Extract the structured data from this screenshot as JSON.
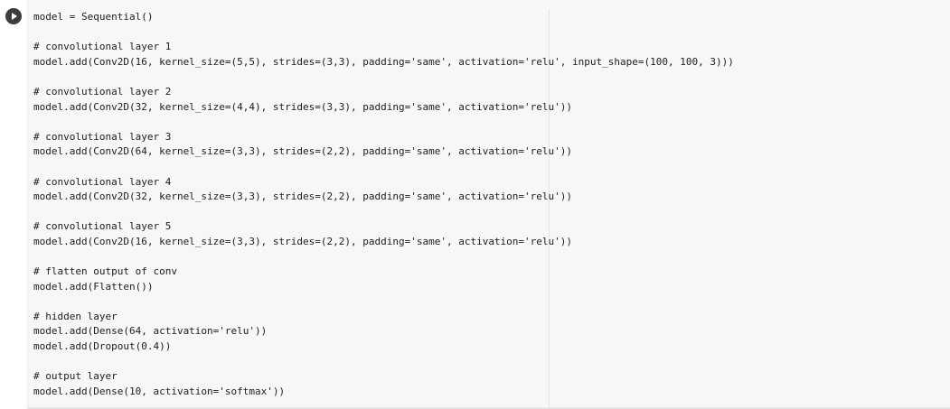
{
  "toolbar": {
    "run_icon": "play-icon"
  },
  "code_lines": [
    "model = Sequential()",
    "",
    "# convolutional layer 1",
    "model.add(Conv2D(16, kernel_size=(5,5), strides=(3,3), padding='same', activation='relu', input_shape=(100, 100, 3)))",
    "",
    "# convolutional layer 2",
    "model.add(Conv2D(32, kernel_size=(4,4), strides=(3,3), padding='same', activation='relu'))",
    "",
    "# convolutional layer 3",
    "model.add(Conv2D(64, kernel_size=(3,3), strides=(2,2), padding='same', activation='relu'))",
    "",
    "# convolutional layer 4",
    "model.add(Conv2D(32, kernel_size=(3,3), strides=(2,2), padding='same', activation='relu'))",
    "",
    "# convolutional layer 5",
    "model.add(Conv2D(16, kernel_size=(3,3), strides=(2,2), padding='same', activation='relu'))",
    "",
    "# flatten output of conv",
    "model.add(Flatten())",
    "",
    "# hidden layer",
    "model.add(Dense(64, activation='relu'))",
    "model.add(Dropout(0.4))",
    "",
    "# output layer",
    "model.add(Dense(10, activation='softmax'))"
  ]
}
